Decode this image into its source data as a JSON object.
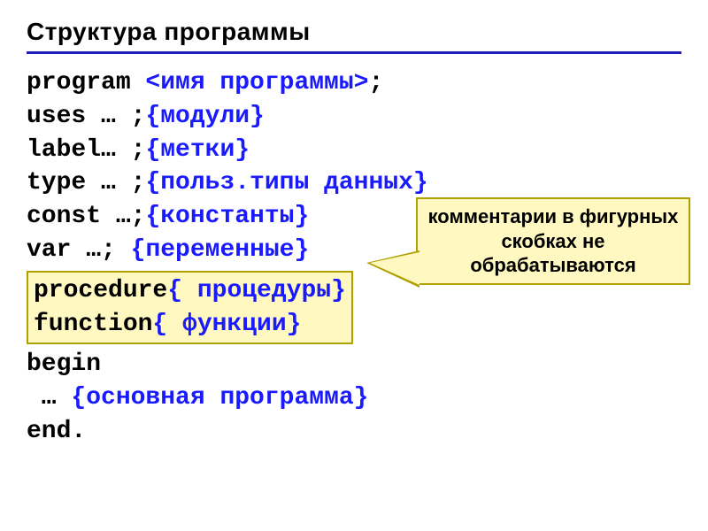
{
  "title": "Структура программы",
  "code": {
    "program_kw": "program ",
    "program_ph": "<имя программы>",
    "program_sc": ";",
    "uses_kw": "uses ",
    "uses_ph": "… ;",
    "uses_cm": "{модули}",
    "label_kw": "label",
    "label_ph": "… ;",
    "label_cm": "{метки}",
    "type_kw": "type ",
    "type_ph": "… ;",
    "type_cm": "{польз.типы данных}",
    "const_kw": "const ",
    "const_ph": "…;",
    "const_cm": "{константы}",
    "var_kw": "var ",
    "var_ph": "…; ",
    "var_cm": "{переменные}",
    "proc_kw": "procedure",
    "proc_cm": "{ процедуры}",
    "func_kw": "function",
    "func_cm": "{ функции}",
    "begin_kw": "begin",
    "main_ph": " … ",
    "main_cm": "{основная программа}",
    "end_kw": "end."
  },
  "callout": "комментарии в фигурных скобках не обрабатываются"
}
